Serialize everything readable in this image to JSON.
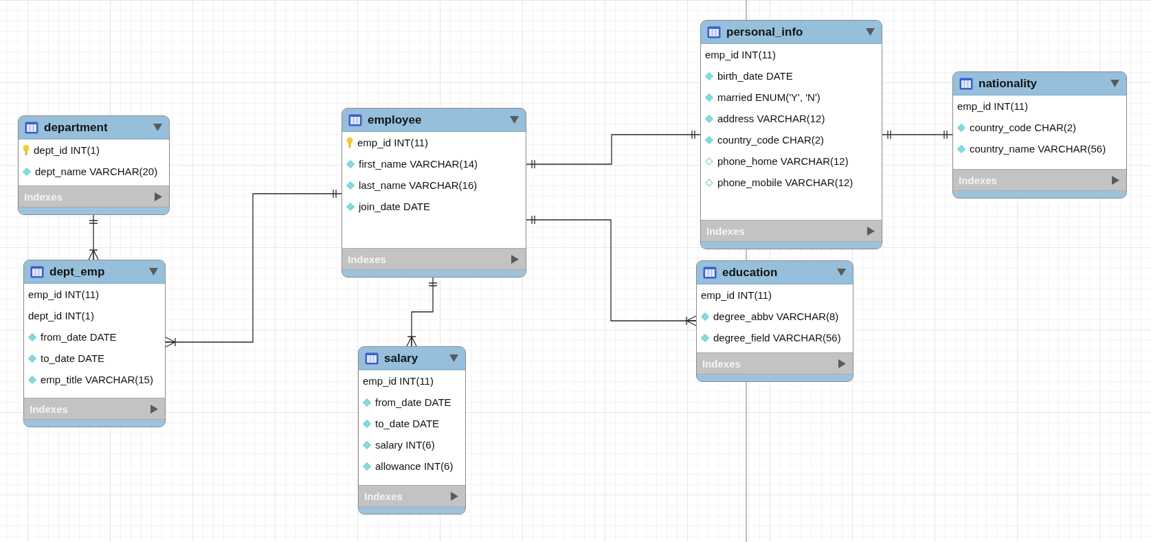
{
  "tables": [
    {
      "name": "department",
      "columns": [
        {
          "kind": "pk",
          "text": "dept_id INT(1)"
        },
        {
          "kind": "attr",
          "text": "dept_name VARCHAR(20)"
        }
      ],
      "indexes": "Indexes"
    },
    {
      "name": "dept_emp",
      "columns": [
        {
          "kind": "plain",
          "text": "emp_id INT(11)"
        },
        {
          "kind": "plain",
          "text": "dept_id INT(1)"
        },
        {
          "kind": "attr",
          "text": "from_date DATE"
        },
        {
          "kind": "attr",
          "text": "to_date DATE"
        },
        {
          "kind": "attr",
          "text": "emp_title VARCHAR(15)"
        }
      ],
      "indexes": "Indexes"
    },
    {
      "name": "employee",
      "columns": [
        {
          "kind": "pk",
          "text": "emp_id INT(11)"
        },
        {
          "kind": "attr",
          "text": "first_name VARCHAR(14)"
        },
        {
          "kind": "attr",
          "text": "last_name VARCHAR(16)"
        },
        {
          "kind": "attr",
          "text": "join_date DATE"
        }
      ],
      "indexes": "Indexes"
    },
    {
      "name": "salary",
      "columns": [
        {
          "kind": "plain",
          "text": "emp_id INT(11)"
        },
        {
          "kind": "attr",
          "text": "from_date DATE"
        },
        {
          "kind": "attr",
          "text": "to_date DATE"
        },
        {
          "kind": "attr",
          "text": "salary INT(6)"
        },
        {
          "kind": "attr",
          "text": "allowance INT(6)"
        }
      ],
      "indexes": "Indexes"
    },
    {
      "name": "personal_info",
      "columns": [
        {
          "kind": "plain",
          "text": "emp_id INT(11)"
        },
        {
          "kind": "attr",
          "text": "birth_date DATE"
        },
        {
          "kind": "attr",
          "text": "married ENUM('Y', 'N')"
        },
        {
          "kind": "attr",
          "text": "address VARCHAR(12)"
        },
        {
          "kind": "attr",
          "text": "country_code CHAR(2)"
        },
        {
          "kind": "nullable",
          "text": "phone_home VARCHAR(12)"
        },
        {
          "kind": "nullable",
          "text": "phone_mobile VARCHAR(12)"
        }
      ],
      "indexes": "Indexes"
    },
    {
      "name": "nationality",
      "columns": [
        {
          "kind": "plain",
          "text": "emp_id INT(11)"
        },
        {
          "kind": "attr",
          "text": "country_code CHAR(2)"
        },
        {
          "kind": "attr",
          "text": "country_name VARCHAR(56)"
        }
      ],
      "indexes": "Indexes"
    },
    {
      "name": "education",
      "columns": [
        {
          "kind": "plain",
          "text": "emp_id INT(11)"
        },
        {
          "kind": "attr",
          "text": "degree_abbv VARCHAR(8)"
        },
        {
          "kind": "attr",
          "text": "degree_field VARCHAR(56)"
        }
      ],
      "indexes": "Indexes"
    }
  ],
  "relationships": [
    {
      "start_many": false,
      "end_many": true
    },
    {
      "start_many": false,
      "end_many": true
    },
    {
      "start_many": false,
      "end_many": false
    },
    {
      "start_many": false,
      "end_many": true
    },
    {
      "start_many": false,
      "end_many": true
    },
    {
      "start_many": false,
      "end_many": false
    }
  ]
}
